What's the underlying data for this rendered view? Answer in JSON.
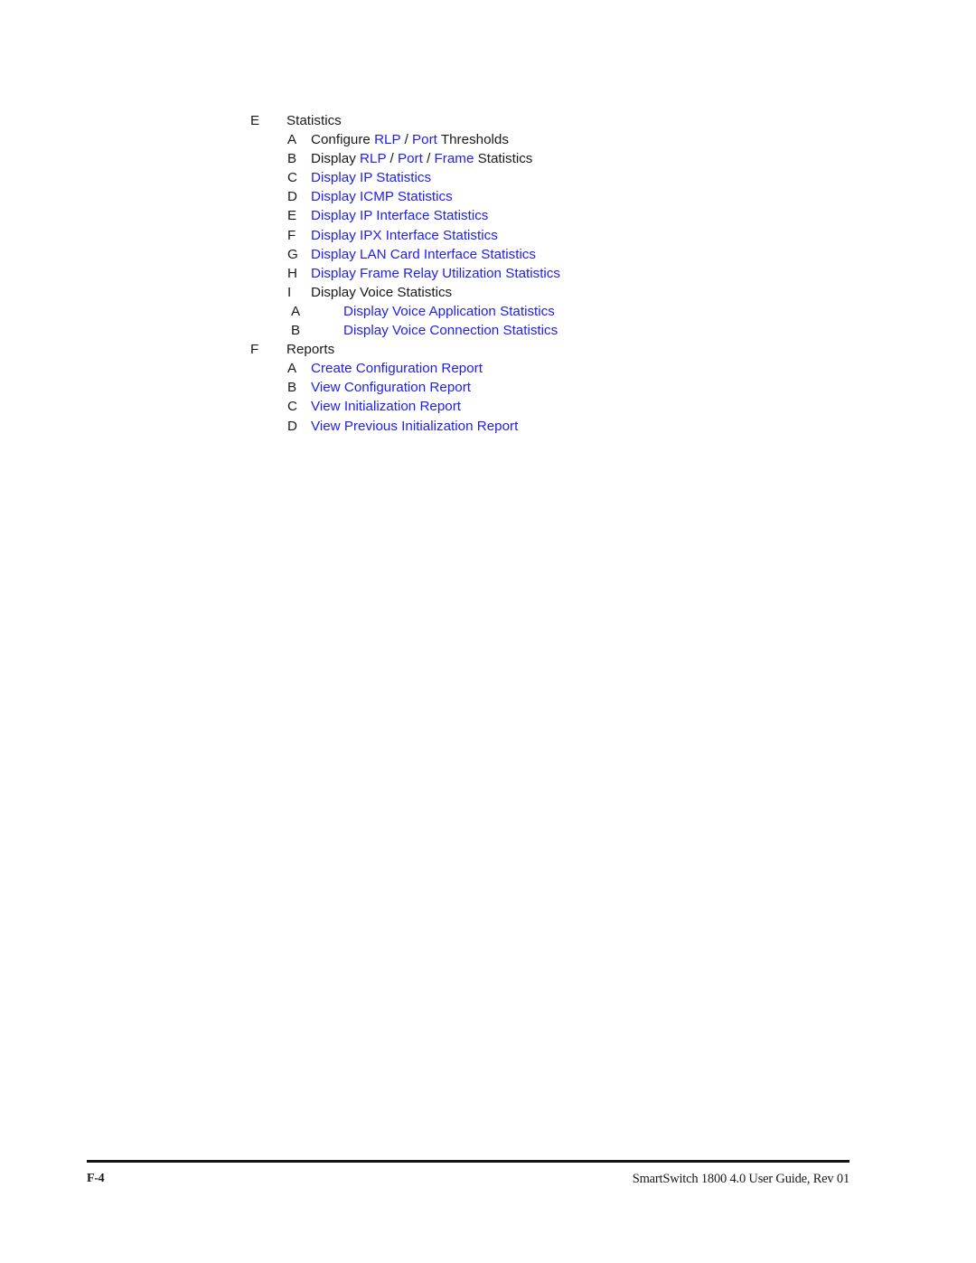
{
  "document": {
    "page_label": "F-4",
    "footer_title": "SmartSwitch 1800 4.0 User Guide, Rev 01",
    "link_color": "#2020ee",
    "text_color": "#1a1a1a"
  },
  "menu": {
    "rows": [
      {
        "level": 1,
        "key": "E",
        "label": "Statistics",
        "style": "plain"
      },
      {
        "level": 2,
        "key": "A",
        "style": "mixed",
        "label": "Configure  RLP / Port  Thresholds",
        "segments": [
          {
            "text": "Configure ",
            "kind": "plain"
          },
          {
            "text": " RLP",
            "kind": "link"
          },
          {
            "text": " / ",
            "kind": "sep"
          },
          {
            "text": "Port",
            "kind": "link"
          },
          {
            "text": "  Thresholds",
            "kind": "plain"
          }
        ]
      },
      {
        "level": 2,
        "key": "B",
        "style": "mixed",
        "label": "Display  RLP / Port / Frame  Statistics",
        "segments": [
          {
            "text": "Display ",
            "kind": "plain"
          },
          {
            "text": " RLP",
            "kind": "link"
          },
          {
            "text": " / ",
            "kind": "sep"
          },
          {
            "text": "Port",
            "kind": "link"
          },
          {
            "text": " / ",
            "kind": "sep"
          },
          {
            "text": "Frame",
            "kind": "link"
          },
          {
            "text": "  Statistics",
            "kind": "plain"
          }
        ]
      },
      {
        "level": 2,
        "key": "C",
        "label": "Display IP Statistics",
        "style": "link"
      },
      {
        "level": 2,
        "key": "D",
        "label": "Display ICMP Statistics",
        "style": "link"
      },
      {
        "level": 2,
        "key": "E",
        "label": "Display IP Interface Statistics",
        "style": "link"
      },
      {
        "level": 2,
        "key": "F",
        "label": "Display IPX Interface Statistics",
        "style": "link"
      },
      {
        "level": 2,
        "key": "G",
        "label": "Display LAN Card Interface Statistics",
        "style": "link"
      },
      {
        "level": 2,
        "key": "H",
        "label": "Display Frame Relay Utilization Statistics",
        "style": "link"
      },
      {
        "level": 2,
        "key": "I",
        "label": "Display Voice Statistics",
        "style": "plain"
      },
      {
        "level": 3,
        "key": "A",
        "label": "Display Voice Application Statistics",
        "style": "link"
      },
      {
        "level": 3,
        "key": "B",
        "label": "Display Voice Connection Statistics",
        "style": "link"
      },
      {
        "level": 1,
        "key": "F",
        "label": "Reports",
        "style": "plain"
      },
      {
        "level": 2,
        "key": "A",
        "label": "Create Configuration Report",
        "style": "link"
      },
      {
        "level": 2,
        "key": "B",
        "label": "View Configuration Report",
        "style": "link"
      },
      {
        "level": 2,
        "key": "C",
        "label": "View Initialization Report",
        "style": "link"
      },
      {
        "level": 2,
        "key": "D",
        "label": "View Previous Initialization Report",
        "style": "link"
      }
    ]
  }
}
